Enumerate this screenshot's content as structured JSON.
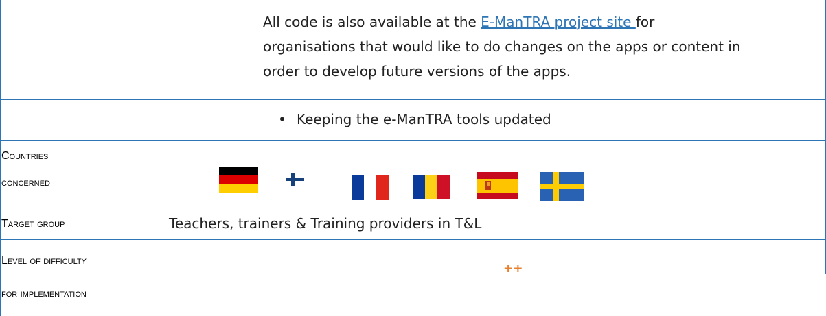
{
  "intro": {
    "text_before_link": "All code is also available at the ",
    "link_text": "E-ManTRA project site ",
    "line1_after": "for",
    "line2": "organisations that would like to do changes on the apps or content in",
    "line3": "order to develop future versions of the apps."
  },
  "bullet": {
    "symbol": "•",
    "text": "Keeping the e-ManTRA tools updated"
  },
  "countries": {
    "label_line1": "Countries",
    "label_line2": "concerned",
    "flags": [
      "germany-flag",
      "finland-flag",
      "france-flag",
      "romania-flag",
      "spain-flag",
      "sweden-flag"
    ]
  },
  "target_group": {
    "label": "Target group",
    "value": "Teachers, trainers & Training providers in T&L"
  },
  "difficulty": {
    "label_line1": "Level of difficulty",
    "label_line2": "for implementation",
    "value": "++"
  },
  "colors": {
    "border": "#2e75b6",
    "link": "#2e75b6",
    "difficulty": "#e8812f"
  }
}
